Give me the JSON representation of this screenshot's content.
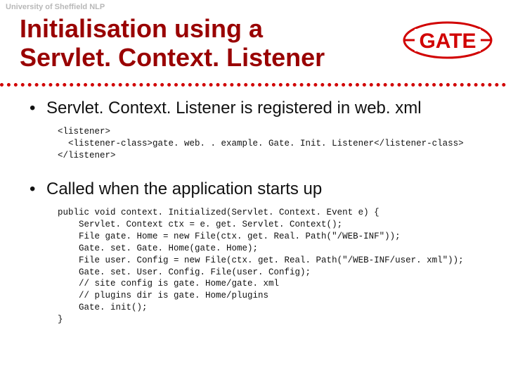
{
  "header": {
    "org_label": "University of Sheffield NLP",
    "title_line1": "Initialisation using a",
    "title_line2": "Servlet. Context. Listener"
  },
  "logo": {
    "text": "GATE",
    "color": "#d10000"
  },
  "bullets": [
    "Servlet. Context. Listener is registered in web. xml",
    "Called when the application starts up"
  ],
  "code_blocks": [
    "<listener>\n  <listener-class>gate. web. . example. Gate. Init. Listener</listener-class>\n</listener>",
    "public void context. Initialized(Servlet. Context. Event e) {\n    Servlet. Context ctx = e. get. Servlet. Context();\n    File gate. Home = new File(ctx. get. Real. Path(\"/WEB-INF\"));\n    Gate. set. Gate. Home(gate. Home);\n    File user. Config = new File(ctx. get. Real. Path(\"/WEB-INF/user. xml\"));\n    Gate. set. User. Config. File(user. Config);\n    // site config is gate. Home/gate. xml\n    // plugins dir is gate. Home/plugins\n    Gate. init();\n}"
  ]
}
